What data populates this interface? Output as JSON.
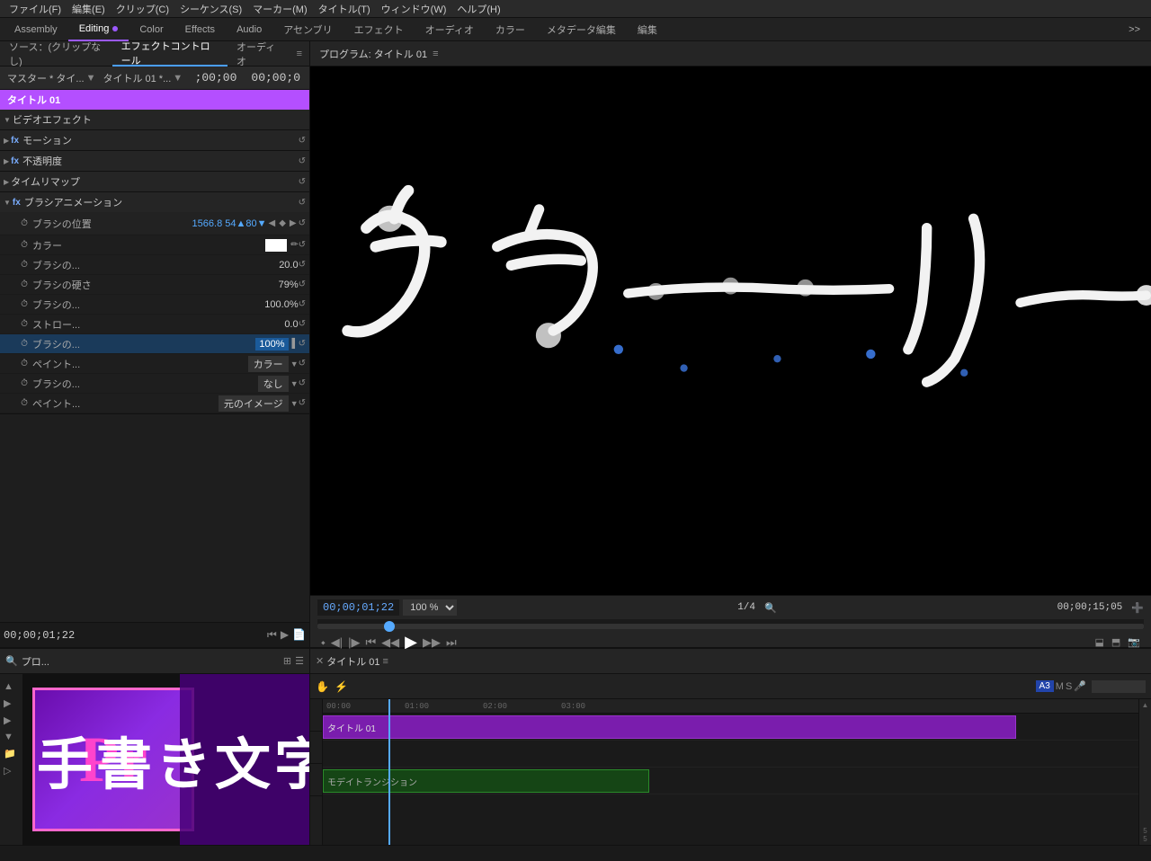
{
  "menu": {
    "items": [
      "ファイル(F)",
      "編集(E)",
      "クリップ(C)",
      "シーケンス(S)",
      "マーカー(M)",
      "タイトル(T)",
      "ウィンドウ(W)",
      "ヘルプ(H)"
    ]
  },
  "workspace": {
    "tabs": [
      "Assembly",
      "Editing",
      "Color",
      "Effects",
      "Audio",
      "アセンブリ",
      "エフェクト",
      "オーディオ",
      "カラー",
      "メタデータ編集",
      "編集"
    ],
    "active": "Editing",
    "more_label": ">>"
  },
  "left_panel": {
    "tabs": [
      "ソース：(クリップなし)",
      "エフェクトコントロール",
      "オーディオ"
    ],
    "active_tab": "エフェクトコントロール",
    "menu_icon": "≡",
    "clip_header": {
      "master": "マスター * タイ...",
      "clip": "タイトル 01 *...",
      "timecode_start": ";00;00",
      "timecode_end": "00;00;0"
    },
    "active_clip": "タイトル 01",
    "sections": {
      "video_effects": "ビデオエフェクト",
      "motion": "モーション",
      "opacity": "不透明度",
      "timemap": "タイムリマップ",
      "brush_animation": "ブラシアニメーション"
    },
    "brush_props": [
      {
        "name": "ブラシの位置",
        "value": "1566.8  54 80",
        "type": "position"
      },
      {
        "name": "カラー",
        "value": "white_swatch",
        "type": "color"
      },
      {
        "name": "ブラシの...",
        "value": "20.0",
        "type": "number"
      },
      {
        "name": "ブラシの硬さ",
        "value": "79%",
        "type": "number"
      },
      {
        "name": "ブラシの...",
        "value": "100.0%",
        "type": "number"
      },
      {
        "name": "ストロー...",
        "value": "0.0",
        "type": "number"
      },
      {
        "name": "ブラシの...",
        "value": "100%",
        "type": "highlight",
        "highlighted": true
      },
      {
        "name": "ペイント...",
        "value": "カラー",
        "type": "dropdown"
      },
      {
        "name": "ブラシの...",
        "value": "なし",
        "type": "dropdown"
      },
      {
        "name": "ペイント...",
        "value": "元のイメージ",
        "type": "dropdown"
      }
    ],
    "bottom_timecode": "00;00;01;22"
  },
  "program_monitor": {
    "title": "プログラム: タイトル 01",
    "menu_icon": "≡",
    "timecode": "00;00;01;22",
    "zoom": "100 %",
    "frame_counter": "1/4",
    "total_time": "00;00;15;05"
  },
  "bottom_panel": {
    "project_title": "プロ...",
    "timeline_tab": "タイトル 01",
    "logo_text": "Pr",
    "japanese_text": "手書き文字講座",
    "track_label": "モデイトランジション"
  },
  "status_bar": {
    "text": ""
  }
}
